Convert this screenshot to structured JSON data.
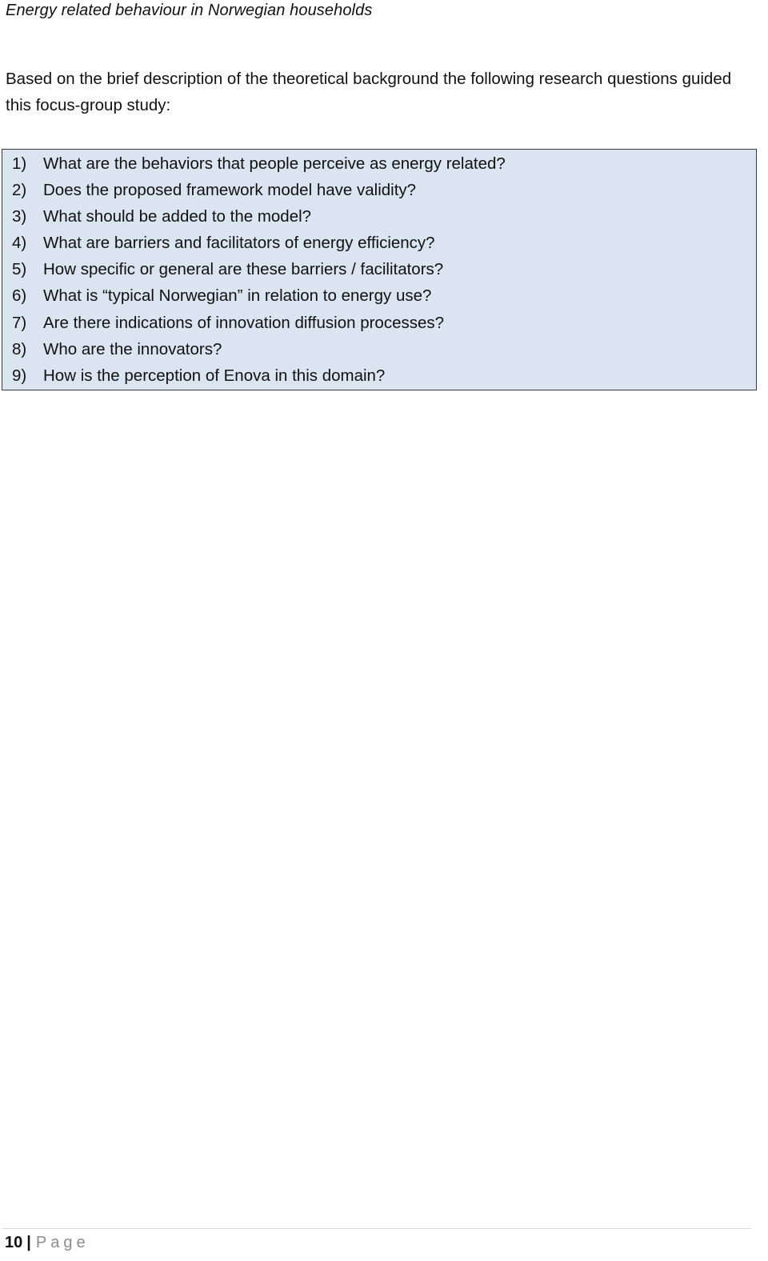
{
  "header": {
    "title": "Energy related behaviour in Norwegian households"
  },
  "intro": {
    "text": "Based on the brief description of the theoretical background the following research questions guided this focus-group study:"
  },
  "research_questions": {
    "items": [
      {
        "num": "1)",
        "text": "What are the behaviors that people perceive as energy related?"
      },
      {
        "num": "2)",
        "text": "Does the proposed framework model have validity?"
      },
      {
        "num": "3)",
        "text": "What should be added to the model?"
      },
      {
        "num": "4)",
        "text": "What are barriers and facilitators of energy efficiency?"
      },
      {
        "num": "5)",
        "text": "How specific or general are these barriers / facilitators?"
      },
      {
        "num": "6)",
        "text": "What is “typical Norwegian” in relation to energy use?"
      },
      {
        "num": "7)",
        "text": "Are there indications of innovation diffusion processes?"
      },
      {
        "num": "8)",
        "text": "Who are the innovators?"
      },
      {
        "num": "9)",
        "text": "How is the perception of Enova in this domain?"
      }
    ]
  },
  "footer": {
    "page_number": "10",
    "separator": "|",
    "page_label": "Page"
  },
  "colors": {
    "box_background": "#dbe5f1",
    "box_border": "#3a3a3a",
    "footer_label": "#8c8c8c"
  }
}
